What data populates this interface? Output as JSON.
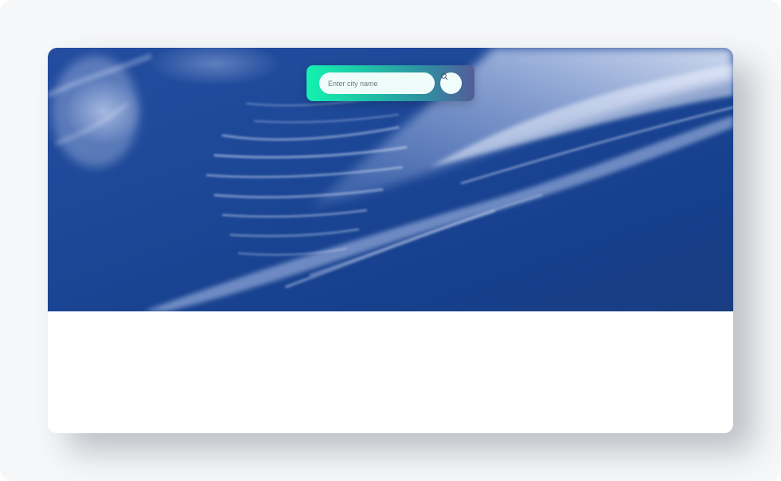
{
  "search": {
    "placeholder": "Enter city name",
    "value": "",
    "button_icon": "search-icon"
  },
  "colors": {
    "page_background": "#f6f7f9",
    "card_background": "#ffffff",
    "sky_blue": "#1c4796",
    "search_gradient_start": "#13f2b0",
    "search_gradient_end": "#545c99"
  }
}
